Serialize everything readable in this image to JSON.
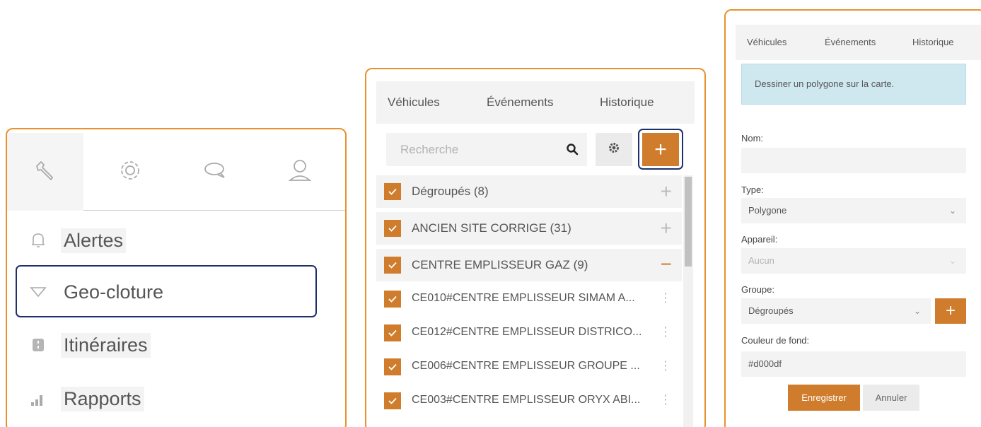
{
  "sidebar": {
    "tabs": [
      {
        "icon": "wrench-icon"
      },
      {
        "icon": "gear-icon"
      },
      {
        "icon": "chat-icon"
      },
      {
        "icon": "user-icon"
      }
    ],
    "menu": [
      {
        "label": "Alertes",
        "icon": "bell-icon"
      },
      {
        "label": "Geo-cloture",
        "icon": "filter-icon"
      },
      {
        "label": "Itinéraires",
        "icon": "road-icon"
      },
      {
        "label": "Rapports",
        "icon": "bar-chart-icon"
      }
    ]
  },
  "list_panel": {
    "tabs": [
      "Véhicules",
      "Événements",
      "Historique"
    ],
    "search_placeholder": "Recherche",
    "add_label": "+",
    "groups": [
      {
        "label": "Dégroupés (8)",
        "sign": "+"
      },
      {
        "label": "ANCIEN SITE CORRIGE (31)",
        "sign": "+"
      },
      {
        "label": "CENTRE EMPLISSEUR GAZ (9)",
        "sign": "−"
      }
    ],
    "devices": [
      "CE010#CENTRE EMPLISSEUR SIMAM A...",
      "CE012#CENTRE EMPLISSEUR DISTRICO...",
      "CE006#CENTRE EMPLISSEUR GROUPE ...",
      "CE003#CENTRE EMPLISSEUR ORYX ABI..."
    ]
  },
  "form_panel": {
    "tabs": [
      "Véhicules",
      "Événements",
      "Historique"
    ],
    "info": "Dessiner un polygone sur la carte.",
    "name_label": "Nom:",
    "name_value": "",
    "type_label": "Type:",
    "type_value": "Polygone",
    "device_label": "Appareil:",
    "device_value": "Aucun",
    "group_label": "Groupe:",
    "group_value": "Dégroupés",
    "color_label": "Couleur de fond:",
    "color_value": "#d000df",
    "save_label": "Enregistrer",
    "cancel_label": "Annuler",
    "chevron": "⌄",
    "plus": "+"
  },
  "colors": {
    "accent": "#cf7d2c",
    "frame": "#e8922e",
    "highlight": "#1f2f6b",
    "info_bg": "#cfe8f0"
  }
}
